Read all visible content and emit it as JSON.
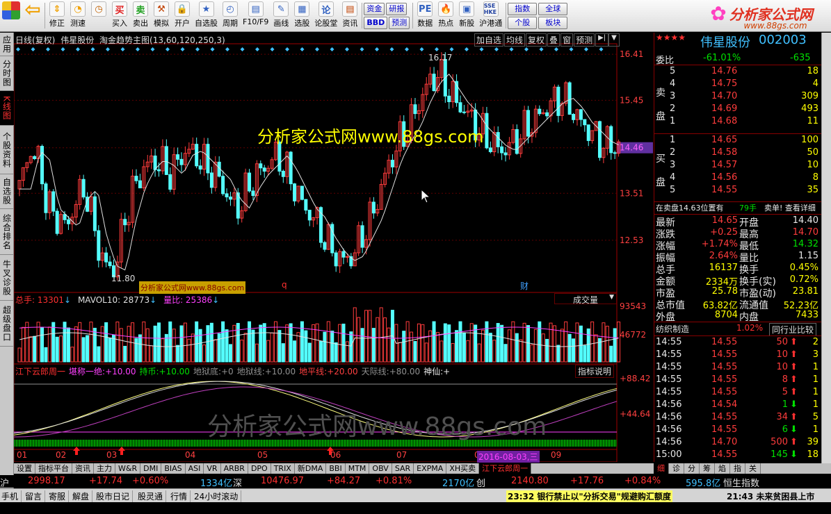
{
  "toolbar": {
    "items": [
      {
        "label": "",
        "icon": "logo-icon"
      },
      {
        "label": "",
        "icon": "back-arrow-icon"
      },
      {
        "label": "修正",
        "icon": "up-down-icon"
      },
      {
        "label": "测速",
        "icon": "speed-icon"
      },
      {
        "label": "",
        "icon": "clock-icon"
      },
      {
        "label": "买入",
        "icon": "buy-icon",
        "glyph": "买"
      },
      {
        "label": "卖出",
        "icon": "sell-icon",
        "glyph": "卖"
      },
      {
        "label": "模拟",
        "icon": "hammer-icon"
      },
      {
        "label": "开户",
        "icon": "lock-icon"
      },
      {
        "label": "自选股",
        "icon": "star-icon"
      },
      {
        "label": "周期",
        "icon": "period-icon"
      },
      {
        "label": "F10/F9",
        "icon": "f10-icon"
      },
      {
        "label": "画线",
        "icon": "pen-icon"
      },
      {
        "label": "选股",
        "icon": "select-icon"
      },
      {
        "label": "论股堂",
        "icon": "forum-icon"
      },
      {
        "label": "资讯",
        "icon": "news-icon"
      }
    ],
    "buttons_row1": [
      "资金",
      "研报"
    ],
    "buttons_row2": [
      "BBD",
      "预测"
    ],
    "items2": [
      {
        "label": "数据",
        "icon": "pe-icon",
        "glyph": "PE"
      },
      {
        "label": "热点",
        "icon": "hot-icon"
      },
      {
        "label": "新股",
        "icon": "new-icon"
      },
      {
        "label": "沪港通",
        "icon": "hk-icon",
        "glyph": "SSE HKE"
      }
    ],
    "buttons2_row1": [
      "指数",
      "全球"
    ],
    "buttons2_row2": [
      "个股",
      "板块"
    ],
    "logo_title": "分析家公式网",
    "logo_url": "www.88gs.com"
  },
  "left_tabs": [
    "应用",
    "分时图",
    "K线图",
    "个股资料",
    "自选股",
    "综合排名",
    "牛叉诊股",
    "超级盘口"
  ],
  "left_tabs_active": 2,
  "chart_header": {
    "title": "日线(复权)",
    "stock": "伟星股份",
    "indicator": "淘金趋势主图(13,60,120,250,3)",
    "buttons": [
      "加自选",
      "均线",
      "复权",
      "叠",
      "窗",
      "预测"
    ]
  },
  "watermark": "分析家公式网www.88gs.com",
  "watermark2": "分析家公式网www.88gs.com",
  "small_watermark": "分析家公式网www.88gs.com",
  "markers": {
    "q": "q",
    "cai": "财"
  },
  "price_axis": [
    "16.41",
    "15.45",
    "14.46",
    "13.51",
    "12.53"
  ],
  "current_price_label": "14.46",
  "annotations": {
    "high": "16.17",
    "low": "11.80"
  },
  "volume_header": {
    "total": "总手: 13301",
    "mavol": "MAVOL10: 28773",
    "ratio": "量比: 25386",
    "dropdown": "成交量"
  },
  "volume_axis": [
    "93543",
    "46772"
  ],
  "indicator_header": {
    "name": "江下云郎周一",
    "items": [
      {
        "label": "堪称一绝:",
        "value": "+10.00",
        "color": "#ff40ff"
      },
      {
        "label": "持币:",
        "value": "+10.00",
        "color": "#00e000"
      },
      {
        "label": "地狱底:",
        "value": "+0",
        "color": "#909090"
      },
      {
        "label": "地狱线:",
        "value": "+10.00",
        "color": "#909090"
      },
      {
        "label": "地平线:",
        "value": "+20.00",
        "color": "#ff4040"
      },
      {
        "label": "天际线:",
        "value": "+80.00",
        "color": "#909090"
      },
      {
        "label": "神仙:",
        "value": "+",
        "color": "#e8e8e8"
      }
    ],
    "help": "指标说明"
  },
  "indicator_axis": [
    "+88.42",
    "+44.64"
  ],
  "date_axis": [
    "01",
    "02",
    "03",
    "04",
    "05",
    "06",
    "07",
    "08",
    "09"
  ],
  "date_cursor": "2016-08-03,三",
  "quote": {
    "name": "伟星股份",
    "code": "002003",
    "weibi_label": "委比",
    "weibi": "-61.01%",
    "weicha": "-635",
    "sell_label": [
      "卖",
      "盘"
    ],
    "buy_label": [
      "买",
      "盘"
    ],
    "sells": [
      {
        "n": "5",
        "p": "14.76",
        "v": "18"
      },
      {
        "n": "4",
        "p": "14.75",
        "v": "4"
      },
      {
        "n": "3",
        "p": "14.70",
        "v": "309"
      },
      {
        "n": "2",
        "p": "14.69",
        "v": "493"
      },
      {
        "n": "1",
        "p": "14.68",
        "v": "11"
      }
    ],
    "buys": [
      {
        "n": "1",
        "p": "14.65",
        "v": "100"
      },
      {
        "n": "2",
        "p": "14.58",
        "v": "50"
      },
      {
        "n": "3",
        "p": "14.57",
        "v": "10"
      },
      {
        "n": "4",
        "p": "14.56",
        "v": "8"
      },
      {
        "n": "5",
        "p": "14.55",
        "v": "35"
      }
    ],
    "notice_left": "在卖盘14.63位置有",
    "notice_mid": "79手",
    "notice_right": "卖单! 查看详细",
    "stats": [
      [
        "最新",
        "14.65",
        "开盘",
        "14.40"
      ],
      [
        "涨跌",
        "+0.25",
        "最高",
        "14.70"
      ],
      [
        "涨幅",
        "+1.74%",
        "最低",
        "14.32"
      ],
      [
        "振幅",
        "2.64%",
        "量比",
        "1.15"
      ],
      [
        "总手",
        "16137",
        "换手",
        "0.45%"
      ],
      [
        "金额",
        "2334万",
        "换手(实)",
        "0.72%"
      ],
      [
        "市盈",
        "25.78",
        "市盈(动)",
        "23.81"
      ],
      [
        "总市值",
        "63.82亿",
        "流通值",
        "52.23亿"
      ],
      [
        "外盘",
        "8704",
        "内盘",
        "7433"
      ]
    ],
    "industry": "纺织制造",
    "industry_pct": "1.02%",
    "industry_compare": "同行业比较",
    "ticks": [
      {
        "t": "14:55",
        "p": "14.55",
        "v": "50",
        "d": "up",
        "x": "2"
      },
      {
        "t": "14:55",
        "p": "14.55",
        "v": "10",
        "d": "up",
        "x": "3"
      },
      {
        "t": "14:55",
        "p": "14.55",
        "v": "10",
        "d": "up",
        "x": "1"
      },
      {
        "t": "14:55",
        "p": "14.55",
        "v": "8",
        "d": "up",
        "x": "1"
      },
      {
        "t": "14:55",
        "p": "14.55",
        "v": "5",
        "d": "up",
        "x": "1"
      },
      {
        "t": "14:56",
        "p": "14.54",
        "v": "1",
        "d": "down",
        "x": "1"
      },
      {
        "t": "14:56",
        "p": "14.55",
        "v": "34",
        "d": "up",
        "x": "5"
      },
      {
        "t": "14:56",
        "p": "14.55",
        "v": "6",
        "d": "down",
        "x": "1"
      },
      {
        "t": "14:56",
        "p": "14.70",
        "v": "500",
        "d": "up",
        "x": "39"
      },
      {
        "t": "15:00",
        "p": "14.55",
        "v": "145",
        "d": "down",
        "x": "18"
      }
    ],
    "side_tabs": [
      "细",
      "诊",
      "分",
      "筹",
      "焰",
      "指",
      "关"
    ]
  },
  "bottom_tabs": [
    "设置",
    "指标平台",
    "资讯",
    "主力",
    "W&R",
    "DMI",
    "BIAS",
    "ASI",
    "VR",
    "ARBR",
    "DPO",
    "TRIX",
    "新DMA",
    "BBI",
    "MTM",
    "OBV",
    "SAR",
    "EXPMA",
    "XH买卖",
    "江下云郎周一"
  ],
  "bottom_tabs_active": 19,
  "index_bar": [
    {
      "name": "沪",
      "val": "2998.17",
      "chg": "+17.74",
      "pct": "+0.60%",
      "amt": "1334亿"
    },
    {
      "name": "深",
      "val": "10476.97",
      "chg": "+84.27",
      "pct": "+0.81%",
      "amt": "2170亿"
    },
    {
      "name": "创",
      "val": "2140.80",
      "chg": "+17.76",
      "pct": "+0.84%",
      "amt": "595.8亿"
    },
    {
      "name": "恒生指数",
      "val": "",
      "chg": "",
      "pct": "",
      "amt": ""
    }
  ],
  "status_items": [
    "手机",
    "留言",
    "寄服",
    "解盘",
    "股市日记",
    "股灵通",
    "行情",
    "24小时滚动"
  ],
  "news1": "23:32 银行禁止以\"分拆交易\"规避购汇额度",
  "news2": "21:43 未来贫困县上市",
  "colors": {
    "up": "#ff3c3c",
    "down": "#54ffff",
    "axis": "#a00000",
    "bg": "#000000"
  },
  "chart_data": {
    "type": "candlestick",
    "title": "伟星股份 日线(复权)",
    "ylim": [
      11.5,
      16.6
    ],
    "y_ticks": [
      12.53,
      13.51,
      14.46,
      15.45,
      16.41
    ],
    "x_ticks": [
      "01",
      "02",
      "03",
      "04",
      "05",
      "06",
      "07",
      "08",
      "09"
    ],
    "high_annotation": 16.17,
    "low_annotation": 11.8,
    "close_points": [
      13.6,
      14.4,
      14.2,
      13.2,
      13.0,
      12.8,
      13.4,
      13.6,
      12.6,
      12.0,
      11.9,
      12.9,
      13.6,
      14.0,
      14.2,
      14.1,
      13.9,
      14.3,
      14.4,
      14.2,
      14.0,
      13.8,
      13.4,
      13.2,
      13.6,
      13.9,
      14.1,
      14.3,
      14.0,
      13.6,
      13.2,
      13.0,
      12.6,
      12.3,
      12.1,
      12.2,
      12.6,
      13.0,
      13.6,
      14.2,
      14.6,
      14.9,
      15.4,
      15.8,
      16.0,
      15.7,
      15.4,
      15.2,
      14.9,
      14.7,
      14.5,
      14.4,
      14.6,
      14.8,
      15.0,
      15.2,
      15.4,
      15.5,
      15.3,
      15.0,
      14.8,
      14.6,
      14.5,
      14.5
    ]
  }
}
